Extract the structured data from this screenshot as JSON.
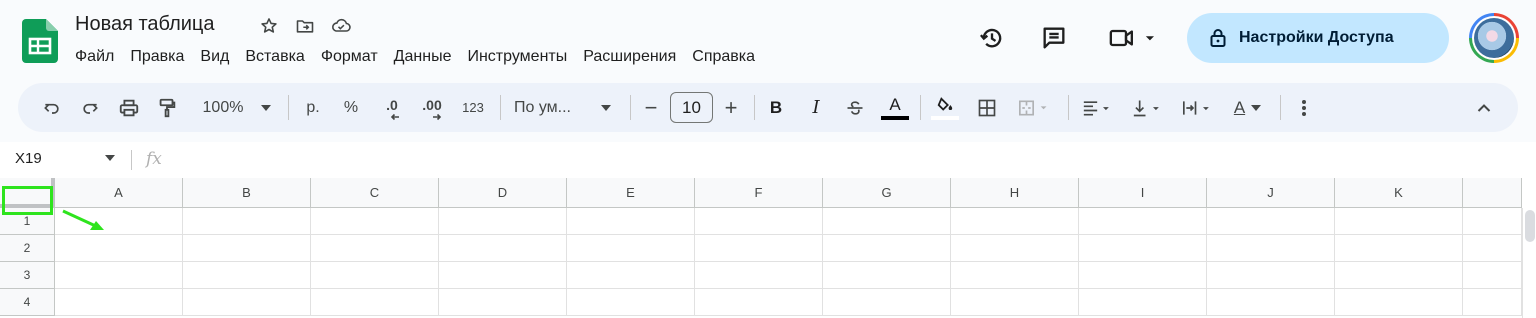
{
  "app": {
    "doc_title": "Новая таблица",
    "icons": {
      "logo": "sheets-logo-icon",
      "star": "star-icon",
      "move": "move-to-folder-icon",
      "cloud": "cloud-saved-icon"
    }
  },
  "menu": {
    "items": [
      "Файл",
      "Правка",
      "Вид",
      "Вставка",
      "Формат",
      "Данные",
      "Инструменты",
      "Расширения",
      "Справка"
    ]
  },
  "header_right": {
    "history_icon": "history-icon",
    "comments_icon": "comments-icon",
    "meet_icon": "video-call-icon",
    "share_label": "Настройки Доступа",
    "share_icon": "lock-icon",
    "avatar_icon": "account-avatar"
  },
  "toolbar": {
    "zoom": "100%",
    "currency": "р.",
    "percent": "%",
    "decrease_decimal": ".0",
    "increase_decimal": ".00",
    "number_format": "123",
    "font": "По ум...",
    "minus": "−",
    "font_size": "10",
    "plus": "+",
    "bold": "B",
    "italic": "I",
    "text_color_letter": "A",
    "halign_letter": "A"
  },
  "formula_bar": {
    "cell_ref": "X19",
    "fx": "fx",
    "value": ""
  },
  "grid": {
    "columns": [
      "A",
      "B",
      "C",
      "D",
      "E",
      "F",
      "G",
      "H",
      "I",
      "J",
      "K"
    ],
    "rows": [
      "1",
      "2",
      "3",
      "4"
    ]
  },
  "colors": {
    "accent_green": "#2ee41d",
    "share_bg": "#c2e7ff",
    "sheets_green": "#0f9d58",
    "toolbar_bg": "#edf2fa"
  }
}
